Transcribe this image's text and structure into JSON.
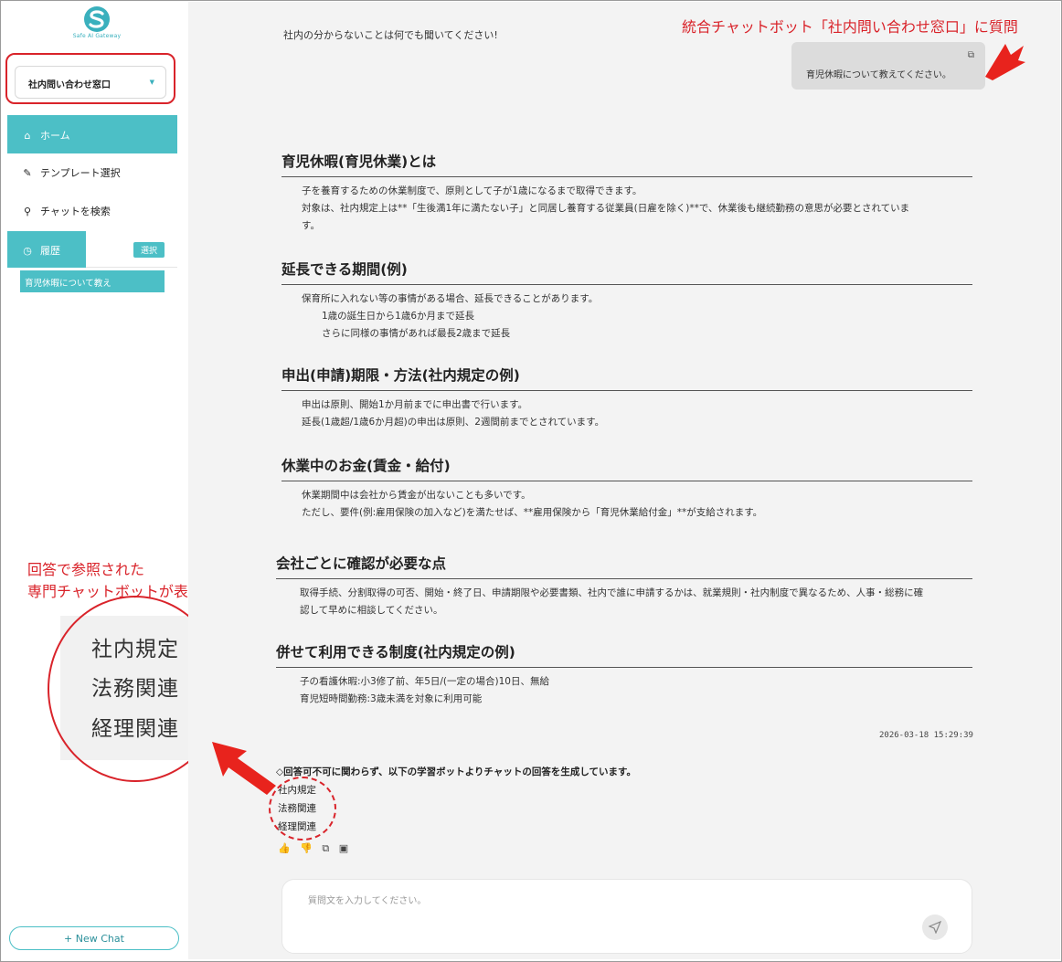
{
  "brand": {
    "name": "Safe AI Gateway",
    "accent": "#4cbfc6",
    "annotation_red": "#d9232a"
  },
  "sidebar": {
    "bot_select": "社内問い合わせ窓口",
    "nav": {
      "home": "ホーム",
      "templates": "テンプレート選択",
      "search": "チャットを検索"
    },
    "history": {
      "label": "履歴",
      "select_badge": "選択",
      "items": [
        "育児休暇について教え"
      ]
    },
    "new_chat": "+ New Chat"
  },
  "annotations": {
    "top_callout": "統合チャットボット「社内問い合わせ窓口」に質問",
    "side_callout_line1": "回答で参照された",
    "side_callout_line2": "専門チャットボットが表示される",
    "zoom_items": [
      "社内規定",
      "法務関連",
      "経理関連"
    ]
  },
  "chat": {
    "intro": "社内の分からないことは何でも聞いてください!",
    "user_message": "育児休暇について教えてください。",
    "sections": [
      {
        "title": "育児休暇(育児休業)とは",
        "lines": [
          "子を養育するための休業制度で、原則として子が1歳になるまで取得できます。",
          "対象は、社内規定上は**「生後満1年に満たない子」と同居し養育する従業員(日雇を除く)**で、休業後も継続勤務の意思が必要とされていま",
          "す。"
        ]
      },
      {
        "title": "延長できる期間(例)",
        "lines": [
          "保育所に入れない等の事情がある場合、延長できることがあります。"
        ],
        "sub": [
          "1歳の誕生日から1歳6か月まで延長",
          "さらに同様の事情があれば最長2歳まで延長"
        ]
      },
      {
        "title": "申出(申請)期限・方法(社内規定の例)",
        "lines": [
          "申出は原則、開始1か月前までに申出書で行います。",
          "延長(1歳超/1歳6か月超)の申出は原則、2週間前までとされています。"
        ]
      },
      {
        "title": "休業中のお金(賃金・給付)",
        "lines": [
          "休業期間中は会社から賃金が出ないことも多いです。",
          "ただし、要件(例:雇用保険の加入など)を満たせば、**雇用保険から「育児休業給付金」**が支給されます。"
        ]
      },
      {
        "title": "会社ごとに確認が必要な点",
        "lines": [
          "取得手続、分割取得の可否、開始・終了日、申請期限や必要書類、社内で誰に申請するかは、就業規則・社内制度で異なるため、人事・総務に確",
          "認して早めに相談してください。"
        ]
      },
      {
        "title": "併せて利用できる制度(社内規定の例)",
        "lines": [
          "子の看護休暇:小3修了前、年5日/(一定の場合)10日、無給",
          "育児短時間勤務:3歳未満を対象に利用可能"
        ]
      }
    ],
    "timestamp": "2026-03-18 15:29:39",
    "notice": "◇回答可不可に関わらず、以下の学習ボットよりチャットの回答を生成しています。",
    "source_bots": [
      "社内規定",
      "法務関連",
      "経理関連"
    ],
    "input_placeholder": "質問文を入力してください。"
  }
}
